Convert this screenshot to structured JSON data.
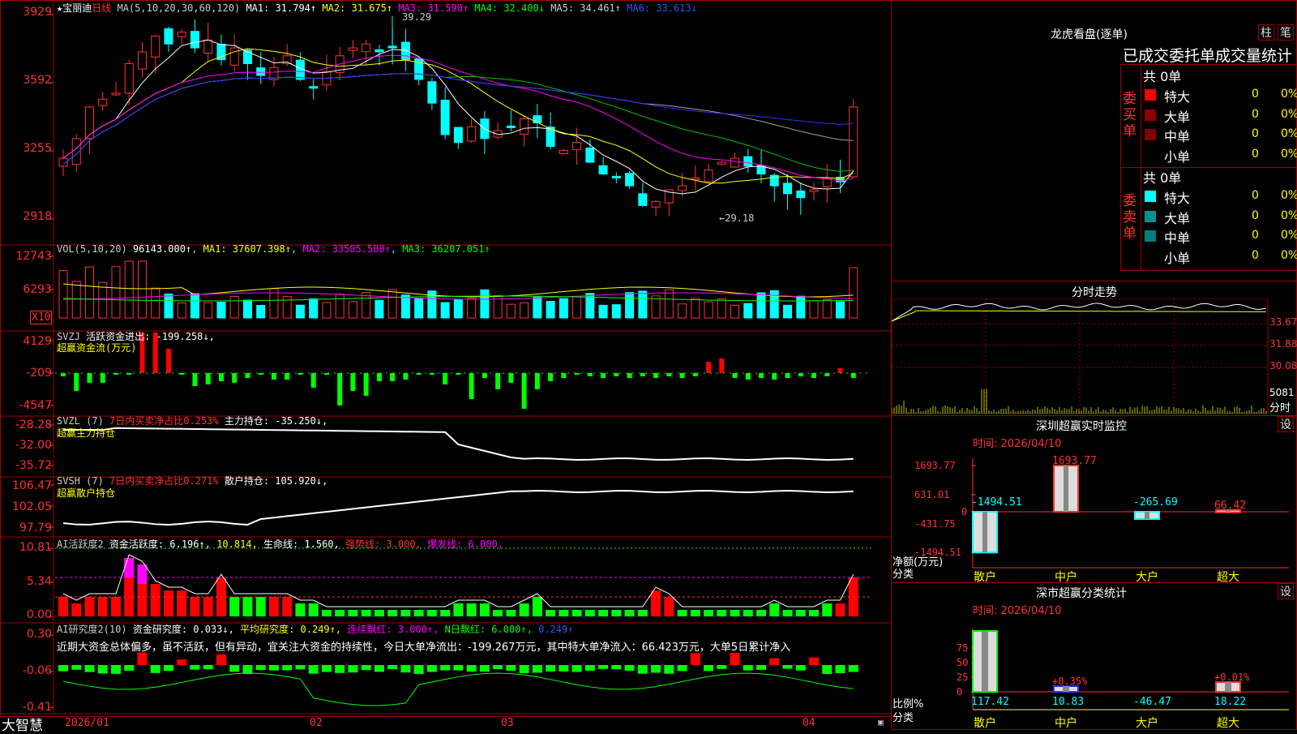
{
  "footer": {
    "brand": "大智慧",
    "months": [
      "2026/01",
      "02",
      "03",
      "04"
    ]
  },
  "kline": {
    "title_star": "★宝丽迪",
    "period": "日线",
    "ma_label": "MA(5,10,20,30,60,120)",
    "ma1": "MA1: 31.794↑",
    "ma2": "MA2: 31.675↑",
    "ma3": "MA3: 31.590↑",
    "ma4": "MA4: 32.400↓",
    "ma5": "MA5: 34.461↑",
    "ma6": "MA6: 33.613↓",
    "axis": [
      "3929",
      "3592",
      "3255",
      "2918"
    ],
    "high_label": "39.29",
    "low_label": "←29.18",
    "colors": {
      "up": "#ff3232",
      "down": "#00ffff",
      "ma1": "#ffffff",
      "ma2": "#ffff00",
      "ma3": "#ff00ff",
      "ma4": "#00c000",
      "ma5": "#a0a0a0",
      "ma6": "#3030ff"
    }
  },
  "vol": {
    "name": "VOL(5,10,20)",
    "value": "96143.000↑",
    "ma1": "MA1: 37607.398↑",
    "ma2": "MA2: 33505.500↑",
    "ma3": "MA3: 36207.051↑",
    "axis": [
      "12743",
      "6293"
    ],
    "unit": "X10"
  },
  "svzj": {
    "name": "SVZJ",
    "label": "活跃资金进出: -199.258↓,",
    "sub": "超赢资金流(万元)",
    "axis": [
      "4129",
      "-209",
      "-4547"
    ]
  },
  "svzl": {
    "name": "SVZL (7)",
    "pct": "7日内买卖净占比0.253%",
    "hold": "主力持仓: -35.250↓,",
    "sub": "超赢主力持仓",
    "axis": [
      "-28.28",
      "-32.00",
      "-35.72"
    ]
  },
  "svsh": {
    "name": "SVSH (7)",
    "pct": "7日内买卖净占比0.271%",
    "hold": "散户持仓: 105.920↓,",
    "sub": "超赢散户持仓",
    "axis": [
      "106.47",
      "102.05",
      "97.79"
    ]
  },
  "ai1": {
    "name": "AI活跃度2",
    "a": "资金活跃度: 6.196↑,",
    "b": "10.814,",
    "c": "生命线: 1.560,",
    "d": "强势线: 3.000,",
    "e": "爆发线: 6.000,",
    "axis": [
      "10.81",
      "5.34",
      "0.00"
    ]
  },
  "ai2": {
    "name": "AI研究度2(10)",
    "a": "资金研究度: 0.033↓,",
    "b": "平均研究度: 0.249↑,",
    "c": "连续飘红: 3.000↑,",
    "d": "N日飘红: 6.000↑,",
    "e": "0.249↑",
    "comment": "近期大资金总体偏多，虽不活跃，但有异动，宜关注大资金的持续性，今日大单净流出：-199.267万元，其中特大单净流入：66.423万元，大单5日累计净入",
    "axis": [
      "0.30",
      "-0.06",
      "-0.41"
    ]
  },
  "lhkp": {
    "title": "龙虎看盘(逐单)",
    "btn1": "柱",
    "btn2": "笔",
    "header": "已成交委托单成交量统计",
    "buy": {
      "side": "委买单",
      "total": "共 0单",
      "rows": [
        {
          "name": "特大",
          "v": "0",
          "p": "0%",
          "c": "#ff0000"
        },
        {
          "name": "大单",
          "v": "0",
          "p": "0%",
          "c": "#900000"
        },
        {
          "name": "中单",
          "v": "0",
          "p": "0%",
          "c": "#800000"
        },
        {
          "name": "小单",
          "v": "0",
          "p": "0%",
          "c": "#000000"
        }
      ]
    },
    "sell": {
      "side": "委卖单",
      "total": "共 0单",
      "rows": [
        {
          "name": "特大",
          "v": "0",
          "p": "0%",
          "c": "#00ffff"
        },
        {
          "name": "大单",
          "v": "0",
          "p": "0%",
          "c": "#009090"
        },
        {
          "name": "中单",
          "v": "0",
          "p": "0%",
          "c": "#008080"
        },
        {
          "name": "小单",
          "v": "0",
          "p": "0%",
          "c": "#000000"
        }
      ]
    }
  },
  "fenshi": {
    "title": "分时走势",
    "axis": [
      "33.67",
      "31.88",
      "30.08"
    ],
    "vol_label": "5081",
    "unit": "分时"
  },
  "monitor": {
    "title": "深圳超赢实时监控",
    "time": "时间: 2026/04/10",
    "btn": "设",
    "axis": [
      "1693.77",
      "631.01",
      "0",
      "-431.75",
      "-1494.51"
    ],
    "side_label": "净额(万元)",
    "cat_label": "分类",
    "cats": [
      "散户",
      "中户",
      "大户",
      "超大"
    ],
    "values": [
      -1494.51,
      1693.77,
      -265.69,
      66.42
    ],
    "labels": [
      "-1494.51",
      "1693.77",
      "-265.69",
      "66.42"
    ]
  },
  "classify": {
    "title": "深市超赢分类统计",
    "time": "时间: 2026/04/10",
    "btn": "设",
    "axis": [
      "75",
      "50",
      "25",
      "0"
    ],
    "side_label": "比例%",
    "cat_label": "分类",
    "cats": [
      "散户",
      "中户",
      "大户",
      "超大"
    ],
    "values": [
      117.42,
      10.83,
      -46.47,
      18.22
    ],
    "labels": [
      "117.42",
      "10.83",
      "-46.47",
      "18.22"
    ],
    "top_labels": [
      "",
      "+0.35%",
      "",
      "+0.01%"
    ]
  }
}
